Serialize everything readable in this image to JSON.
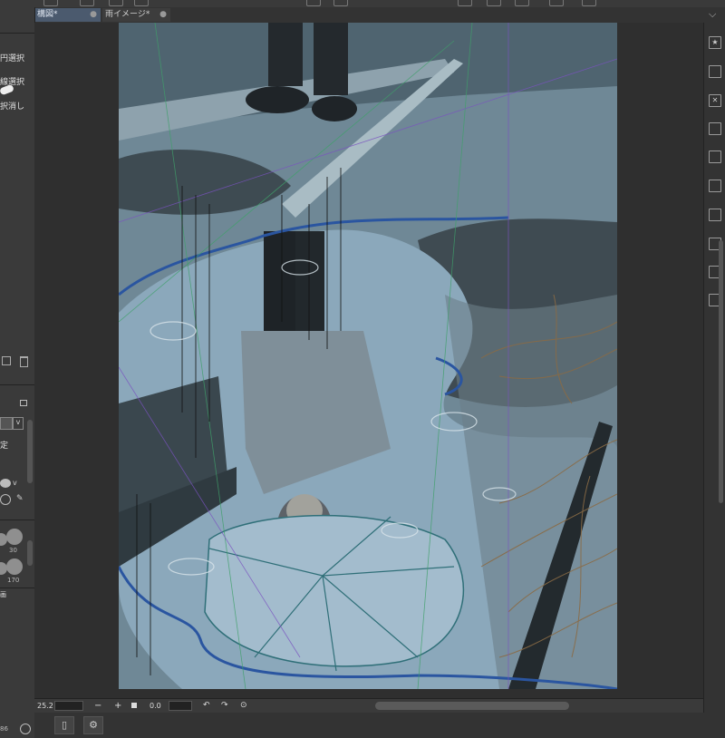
{
  "tabs": [
    {
      "label": "構図*",
      "close": "●"
    },
    {
      "label": "雨イメージ*",
      "close": "●"
    }
  ],
  "tab_menu_icon": "chevron-down-icon",
  "left_panel": {
    "items": [
      "円選択",
      "線選択",
      "択消し"
    ],
    "lock_icon": "lock-icon",
    "brush_sizes": [
      "30",
      "170"
    ],
    "setting_label": "定",
    "bottom_label": "画",
    "bottom_number": "86"
  },
  "statusbar": {
    "zoom": "25.2",
    "zoom_minus": "−",
    "zoom_plus": "+",
    "rotation": "0.0"
  },
  "colors": {
    "active_tab": "#4b5a6e",
    "canvas_bg": "#2f2f2f",
    "artwork_base": "#6d8593"
  }
}
